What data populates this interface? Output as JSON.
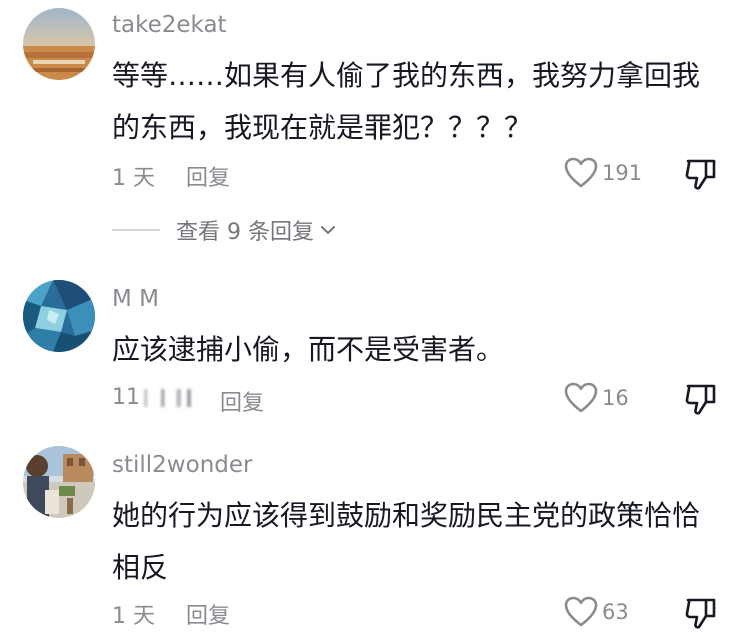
{
  "comments": [
    {
      "username": "take2ekat",
      "text": "等等……如果有人偷了我的东西，我努力拿回我的东西，我现在就是罪犯？？？？",
      "time": "1 天",
      "reply_label": "回复",
      "likes": "191",
      "avatar_icon": "desert-landscape-avatar"
    },
    {
      "username": "M M",
      "text": "应该逮捕小偷，而不是受害者。",
      "time": "11",
      "reply_label": "回复",
      "likes": "16",
      "avatar_icon": "blue-abstract-avatar"
    },
    {
      "username": "still2wonder",
      "text": "她的行为应该得到鼓励和奖励民主党的政策恰恰相反",
      "time": "1 天",
      "reply_label": "回复",
      "likes": "63",
      "avatar_icon": "street-photo-avatar"
    }
  ],
  "view_replies": {
    "label": "查看 9 条回复"
  },
  "icons": {
    "like": "heart-outline-icon",
    "dislike": "thumbs-down-icon",
    "expand": "chevron-down-icon"
  },
  "colors": {
    "text_primary": "#161823",
    "text_secondary": "#8a8b91",
    "divider": "#d5d6d8"
  }
}
